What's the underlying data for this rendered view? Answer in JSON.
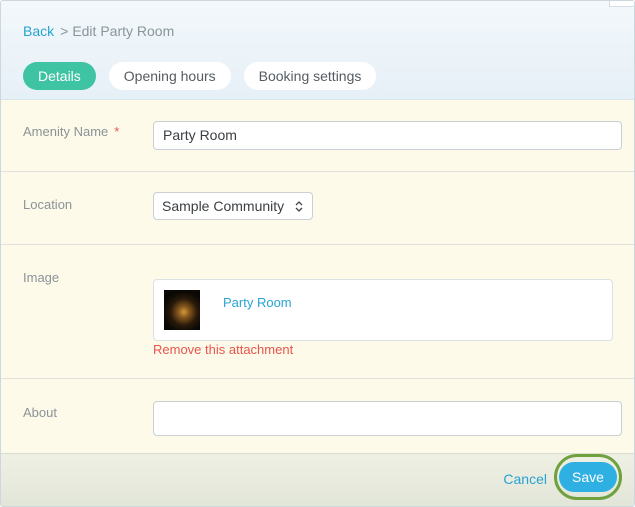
{
  "breadcrumb": {
    "back": "Back",
    "separator": ">",
    "current": "Edit Party Room"
  },
  "tabs": [
    {
      "label": "Details",
      "active": true
    },
    {
      "label": "Opening hours",
      "active": false
    },
    {
      "label": "Booking settings",
      "active": false
    }
  ],
  "form": {
    "amenity_name": {
      "label": "Amenity Name",
      "required_mark": "*",
      "value": "Party Room"
    },
    "location": {
      "label": "Location",
      "selected": "Sample Community",
      "arrows": "⌃⌄"
    },
    "image": {
      "label": "Image",
      "attachment_name": "Party Room",
      "remove_label": "Remove this attachment"
    },
    "about": {
      "label": "About",
      "value": ""
    }
  },
  "footer": {
    "cancel_label": "Cancel",
    "save_label": "Save"
  },
  "colors": {
    "accent": "#27a4d3",
    "active_tab": "#3ec4a3",
    "danger": "#e8554e",
    "save_button": "#2fb0e3",
    "save_highlight_ring": "#6fa13f"
  }
}
